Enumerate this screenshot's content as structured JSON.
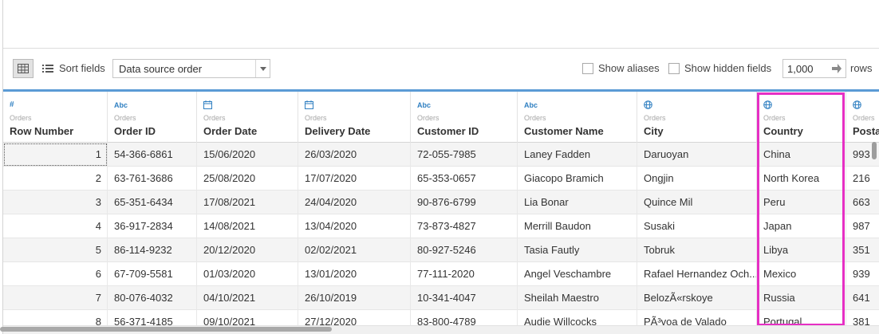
{
  "toolbar": {
    "sort_label": "Sort fields",
    "sort_value": "Data source order",
    "show_aliases": "Show aliases",
    "show_hidden": "Show hidden fields",
    "rows_value": "1,000",
    "rows_label": "rows",
    "grid_icon": "grid-view-icon",
    "list_icon": "list-view-icon"
  },
  "columns": [
    {
      "type_icon": "#",
      "source": "Orders",
      "name": "Row Number"
    },
    {
      "type_icon": "Abc",
      "source": "Orders",
      "name": "Order ID"
    },
    {
      "type_icon": "calendar",
      "source": "Orders",
      "name": "Order Date"
    },
    {
      "type_icon": "calendar",
      "source": "Orders",
      "name": "Delivery Date"
    },
    {
      "type_icon": "Abc",
      "source": "Orders",
      "name": "Customer ID"
    },
    {
      "type_icon": "Abc",
      "source": "Orders",
      "name": "Customer Name"
    },
    {
      "type_icon": "globe",
      "source": "Orders",
      "name": "City"
    },
    {
      "type_icon": "globe",
      "source": "Orders",
      "name": "Country"
    },
    {
      "type_icon": "globe",
      "source": "Orders",
      "name": "Posta"
    }
  ],
  "rows": [
    [
      "1",
      "54-366-6861",
      "15/06/2020",
      "26/03/2020",
      "72-055-7985",
      "Laney Fadden",
      "Daruoyan",
      "China",
      "993"
    ],
    [
      "2",
      "63-761-3686",
      "25/08/2020",
      "17/07/2020",
      "65-353-0657",
      "Giacopo Bramich",
      "Ongjin",
      "North Korea",
      "216"
    ],
    [
      "3",
      "65-351-6434",
      "17/08/2021",
      "24/04/2020",
      "90-876-6799",
      "Lia Bonar",
      "Quince Mil",
      "Peru",
      "663"
    ],
    [
      "4",
      "36-917-2834",
      "14/08/2021",
      "13/04/2020",
      "73-873-4827",
      "Merrill Baudon",
      "Susaki",
      "Japan",
      "987"
    ],
    [
      "5",
      "86-114-9232",
      "20/12/2020",
      "02/02/2021",
      "80-927-5246",
      "Tasia Fautly",
      "Tobruk",
      "Libya",
      "351"
    ],
    [
      "6",
      "67-709-5581",
      "01/03/2020",
      "13/01/2020",
      "77-111-2020",
      "Angel Veschambre",
      "Rafael Hernandez Och...",
      "Mexico",
      "939"
    ],
    [
      "7",
      "80-076-4032",
      "04/10/2021",
      "26/10/2019",
      "10-341-4047",
      "Sheilah Maestro",
      "BelozÃ«rskoye",
      "Russia",
      "641"
    ],
    [
      "8",
      "56-371-4185",
      "09/10/2021",
      "27/12/2020",
      "83-800-4789",
      "Audie Willcocks",
      "PÃ³voa de Valado",
      "Portugal",
      "381"
    ]
  ]
}
